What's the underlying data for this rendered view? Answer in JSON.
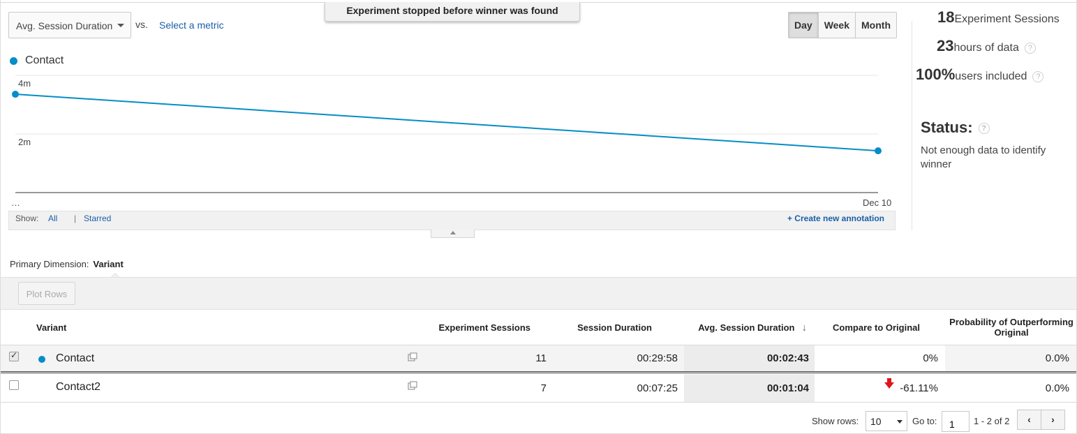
{
  "header": {
    "metric_select": "Avg. Session Duration",
    "vs_label": "vs.",
    "select_metric_link": "Select a metric",
    "banner": "Experiment stopped before winner was found",
    "periods": [
      "Day",
      "Week",
      "Month"
    ],
    "active_period": "Day"
  },
  "legend": {
    "label": "Contact",
    "color": "#058dc7"
  },
  "chart_data": {
    "type": "line",
    "series": [
      {
        "name": "Contact",
        "values": [
          3.65,
          1.55
        ]
      }
    ],
    "x": [
      "…",
      "Dec 10"
    ],
    "y_ticks": [
      "4m",
      "2m"
    ],
    "ylim": [
      0,
      4.35
    ],
    "grid": true,
    "color": "#058dc7"
  },
  "annotations": {
    "show_label": "Show:",
    "all_link": "All",
    "separator": "|",
    "starred_link": "Starred",
    "create_link": "+ Create new annotation"
  },
  "stats": {
    "sessions_num": "18",
    "sessions_label": "Experiment Sessions",
    "hours_num": "23",
    "hours_label": "hours of data",
    "users_num": "100%",
    "users_label": "users included",
    "help_mark": "?",
    "status_title": "Status:",
    "status_text": "Not enough data to identify winner"
  },
  "dimension": {
    "label": "Primary Dimension:",
    "value": "Variant"
  },
  "toolbar": {
    "plot_rows": "Plot Rows"
  },
  "table": {
    "headers": {
      "variant": "Variant",
      "sessions": "Experiment Sessions",
      "duration": "Session Duration",
      "avg_duration": "Avg. Session Duration",
      "sort_icon": "↓",
      "compare": "Compare to Original",
      "probability": "Probability of Outperforming Original"
    },
    "rows": [
      {
        "checked": true,
        "variant": "Contact",
        "sessions": "11",
        "duration": "00:29:58",
        "avg_duration": "00:02:43",
        "compare": "0%",
        "probability": "0.0%"
      },
      {
        "checked": false,
        "variant": "Contact2",
        "sessions": "7",
        "duration": "00:07:25",
        "avg_duration": "00:01:04",
        "compare": "-61.11%",
        "probability": "0.0%"
      }
    ]
  },
  "pager": {
    "show_rows_label": "Show rows:",
    "rows_value": "10",
    "goto_label": "Go to:",
    "goto_value": "1",
    "range": "1 - 2 of 2",
    "prev": "‹",
    "next": "›"
  }
}
